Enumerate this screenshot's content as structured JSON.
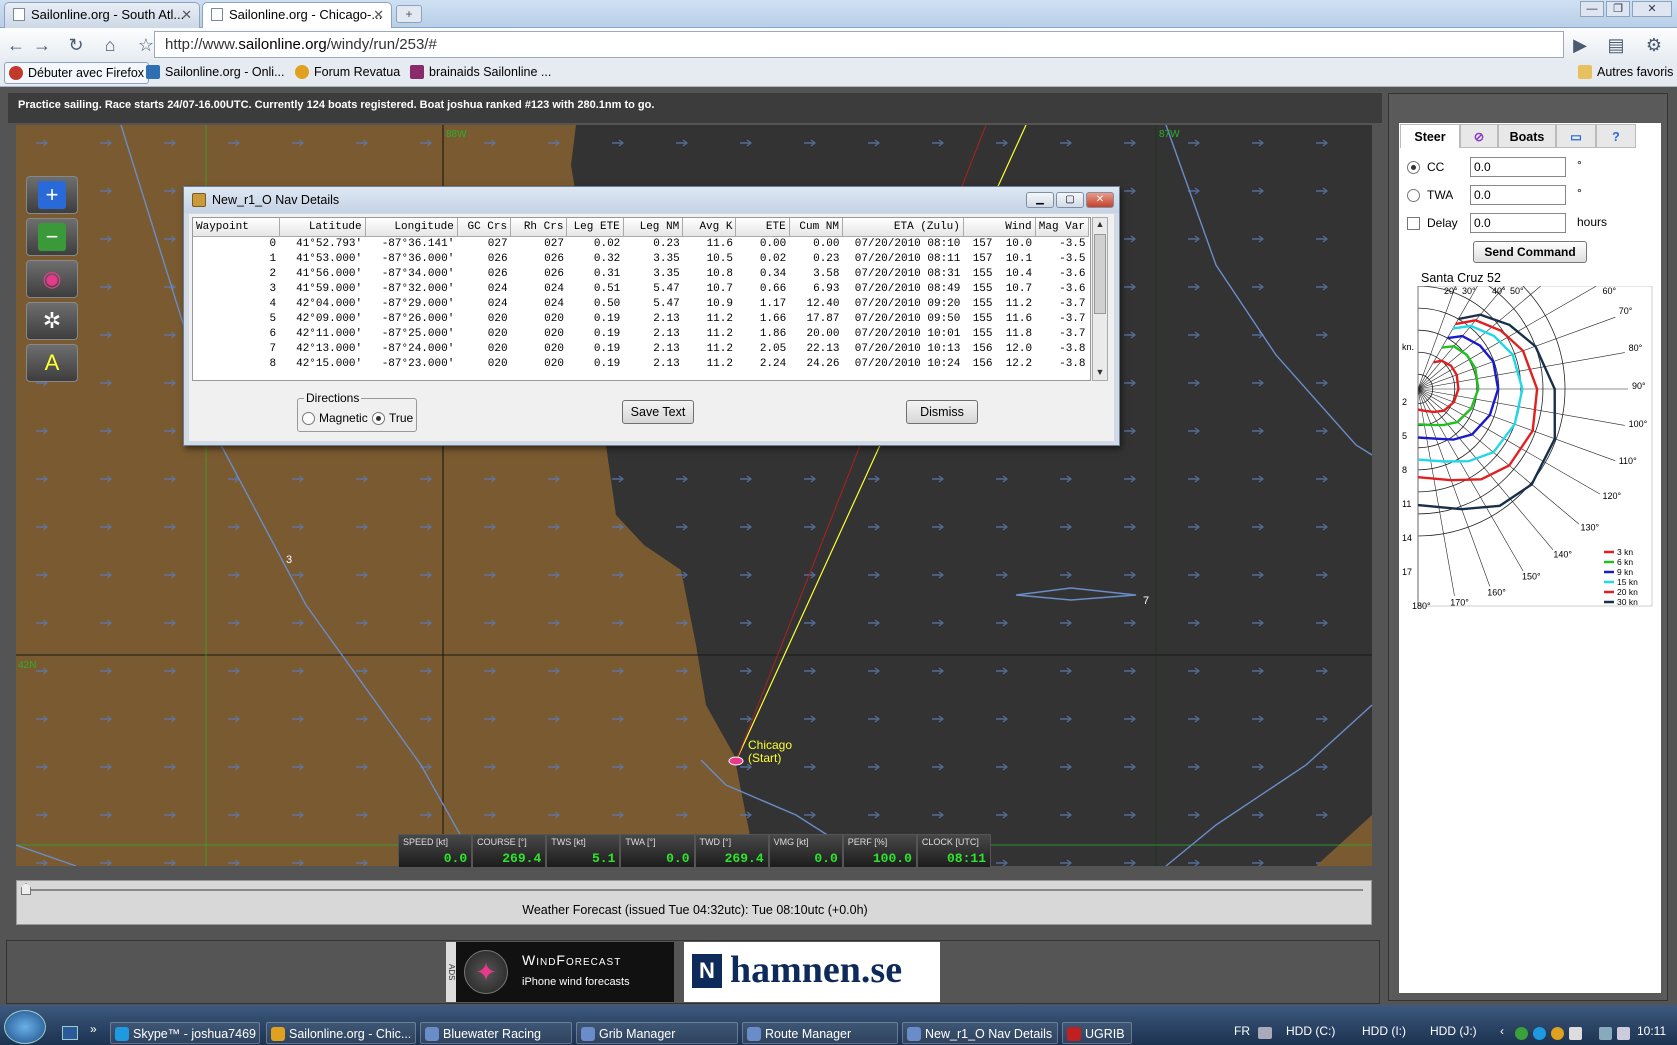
{
  "browser": {
    "tabs": [
      {
        "title": "Sailonline.org - South Atl...",
        "active": false
      },
      {
        "title": "Sailonline.org - Chicago-...",
        "active": true
      }
    ],
    "url_domain_prefix": "http://www.",
    "url_domain": "sailonline.org",
    "url_path": "/windy/run/253/#",
    "bookmarks": [
      {
        "label": "Débuter avec Firefox",
        "color": "#c0392b"
      },
      {
        "label": "Sailonline.org - Onli...",
        "color": "#2f6fb3"
      },
      {
        "label": "Forum Revatua",
        "color": "#e0a020"
      },
      {
        "label": "brainaids Sailonline ...",
        "color": "#8a2a6a"
      }
    ],
    "other_bookmarks": "Autres favoris"
  },
  "race": {
    "status": "Practice sailing. Race starts 24/07-16.00UTC. Currently 124 boats registered. Boat joshua ranked #123 with 280.1nm to go."
  },
  "map": {
    "grid_labels": {
      "lon_88": "88W",
      "lon_87": "87W",
      "lat_42": "42N"
    },
    "waypoint_3": "3",
    "waypoint_7": "7",
    "start_label_1": "Chicago",
    "start_label_2": "(Start)",
    "colors": {
      "land": "#7a5a30",
      "water": "#333333",
      "route": "#6a8cc8",
      "heading": "#ffff33",
      "track": "#c0392b"
    }
  },
  "map_tools": [
    {
      "name": "zoom-in",
      "glyph": "+"
    },
    {
      "name": "zoom-out",
      "glyph": "−"
    },
    {
      "name": "compass",
      "glyph": "◉"
    },
    {
      "name": "helm",
      "glyph": "✲"
    },
    {
      "name": "route-tool",
      "glyph": "A"
    }
  ],
  "instruments": [
    {
      "label": "SPEED [kt]",
      "value": "0.0"
    },
    {
      "label": "COURSE [°]",
      "value": "269.4"
    },
    {
      "label": "TWS [kt]",
      "value": "5.1"
    },
    {
      "label": "TWA [°]",
      "value": "0.0"
    },
    {
      "label": "TWD [°]",
      "value": "269.4"
    },
    {
      "label": "VMG [kt]",
      "value": "0.0"
    },
    {
      "label": "PERF [%]",
      "value": "100.0"
    },
    {
      "label": "CLOCK [UTC]",
      "value": "08:11"
    }
  ],
  "weather": {
    "forecast_label": "Weather Forecast  (issued Tue 04:32utc): Tue 08:10utc  (+0.0h)"
  },
  "ads": {
    "windforecast_title": "WindForecast",
    "windforecast_sub": "iPhone wind forecasts",
    "hamnen": "hamnen.se",
    "side_text": "ADS"
  },
  "nav_dialog": {
    "title": "New_r1_O Nav Details",
    "columns": [
      "Waypoint",
      "Latitude",
      "Longitude",
      "GC Crs",
      "Rh Crs",
      "Leg ETE",
      "Leg NM",
      "Avg K",
      "ETE",
      "Cum NM",
      "ETA (Zulu)",
      "Wind",
      "Mag Var"
    ],
    "rows": [
      [
        "0",
        "41°52.793'",
        "-87°36.141'",
        "027",
        "027",
        "0.02",
        "0.23",
        "11.6",
        "0.00",
        "0.00",
        "07/20/2010 08:10",
        "157  10.0",
        "-3.5"
      ],
      [
        "1",
        "41°53.000'",
        "-87°36.000'",
        "026",
        "026",
        "0.32",
        "3.35",
        "10.5",
        "0.02",
        "0.23",
        "07/20/2010 08:11",
        "157  10.1",
        "-3.5"
      ],
      [
        "2",
        "41°56.000'",
        "-87°34.000'",
        "026",
        "026",
        "0.31",
        "3.35",
        "10.8",
        "0.34",
        "3.58",
        "07/20/2010 08:31",
        "155  10.4",
        "-3.6"
      ],
      [
        "3",
        "41°59.000'",
        "-87°32.000'",
        "024",
        "024",
        "0.51",
        "5.47",
        "10.7",
        "0.66",
        "6.93",
        "07/20/2010 08:49",
        "155  10.7",
        "-3.6"
      ],
      [
        "4",
        "42°04.000'",
        "-87°29.000'",
        "024",
        "024",
        "0.50",
        "5.47",
        "10.9",
        "1.17",
        "12.40",
        "07/20/2010 09:20",
        "155  11.2",
        "-3.7"
      ],
      [
        "5",
        "42°09.000'",
        "-87°26.000'",
        "020",
        "020",
        "0.19",
        "2.13",
        "11.2",
        "1.66",
        "17.87",
        "07/20/2010 09:50",
        "155  11.6",
        "-3.7"
      ],
      [
        "6",
        "42°11.000'",
        "-87°25.000'",
        "020",
        "020",
        "0.19",
        "2.13",
        "11.2",
        "1.86",
        "20.00",
        "07/20/2010 10:01",
        "155  11.8",
        "-3.7"
      ],
      [
        "7",
        "42°13.000'",
        "-87°24.000'",
        "020",
        "020",
        "0.19",
        "2.13",
        "11.2",
        "2.05",
        "22.13",
        "07/20/2010 10:13",
        "156  12.0",
        "-3.8"
      ],
      [
        "8",
        "42°15.000'",
        "-87°23.000'",
        "020",
        "020",
        "0.19",
        "2.13",
        "11.2",
        "2.24",
        "24.26",
        "07/20/2010 10:24",
        "156  12.2",
        "-3.8"
      ]
    ],
    "directions_legend": "Directions",
    "magnetic_label": "Magnetic",
    "true_label": "True",
    "save_label": "Save Text",
    "dismiss_label": "Dismiss"
  },
  "steer_panel": {
    "tabs": [
      "Steer",
      "Boats"
    ],
    "cc_label": "CC",
    "cc_value": "0.0",
    "twa_label": "TWA",
    "twa_value": "0.0",
    "delay_label": "Delay",
    "delay_value": "0.0",
    "deg_unit": "°",
    "hours_unit": "hours",
    "send_label": "Send Command",
    "polar_title": "Santa Cruz 52",
    "polar_kn_label": "kn.",
    "polar_speed_ticks": [
      "2",
      "5",
      "8",
      "11",
      "14",
      "17"
    ],
    "polar_angle_labels": [
      "20°",
      "30°",
      "40°",
      "50°",
      "60°",
      "70°",
      "80°",
      "90°",
      "100°",
      "110°",
      "120°",
      "130°",
      "140°",
      "150°",
      "160°",
      "170°",
      "180°"
    ],
    "polar_legend": [
      {
        "label": "3 kn",
        "color": "#e02020"
      },
      {
        "label": "6 kn",
        "color": "#20c020"
      },
      {
        "label": "9 kn",
        "color": "#1a1ac8"
      },
      {
        "label": "15 kn",
        "color": "#20d8e8"
      },
      {
        "label": "20 kn",
        "color": "#e02020"
      },
      {
        "label": "30 kn",
        "color": "#18304a"
      }
    ]
  },
  "taskbar": {
    "items": [
      {
        "label": "Skype™ - joshua7469",
        "color": "#1e9ae0"
      },
      {
        "label": "Sailonline.org - Chic...",
        "color": "#e0a020"
      },
      {
        "label": "Bluewater Racing",
        "color": "#6a8cc8"
      },
      {
        "label": "Grib Manager",
        "color": "#6a8cc8"
      },
      {
        "label": "Route Manager",
        "color": "#6a8cc8"
      },
      {
        "label": "New_r1_O Nav Details",
        "color": "#6a8cc8"
      },
      {
        "label": "UGRIB",
        "color": "#c02020"
      }
    ],
    "lang": "FR",
    "drives": [
      "HDD (C:)",
      "HDD (I:)",
      "HDD (J:)"
    ],
    "clock": "10:11"
  }
}
